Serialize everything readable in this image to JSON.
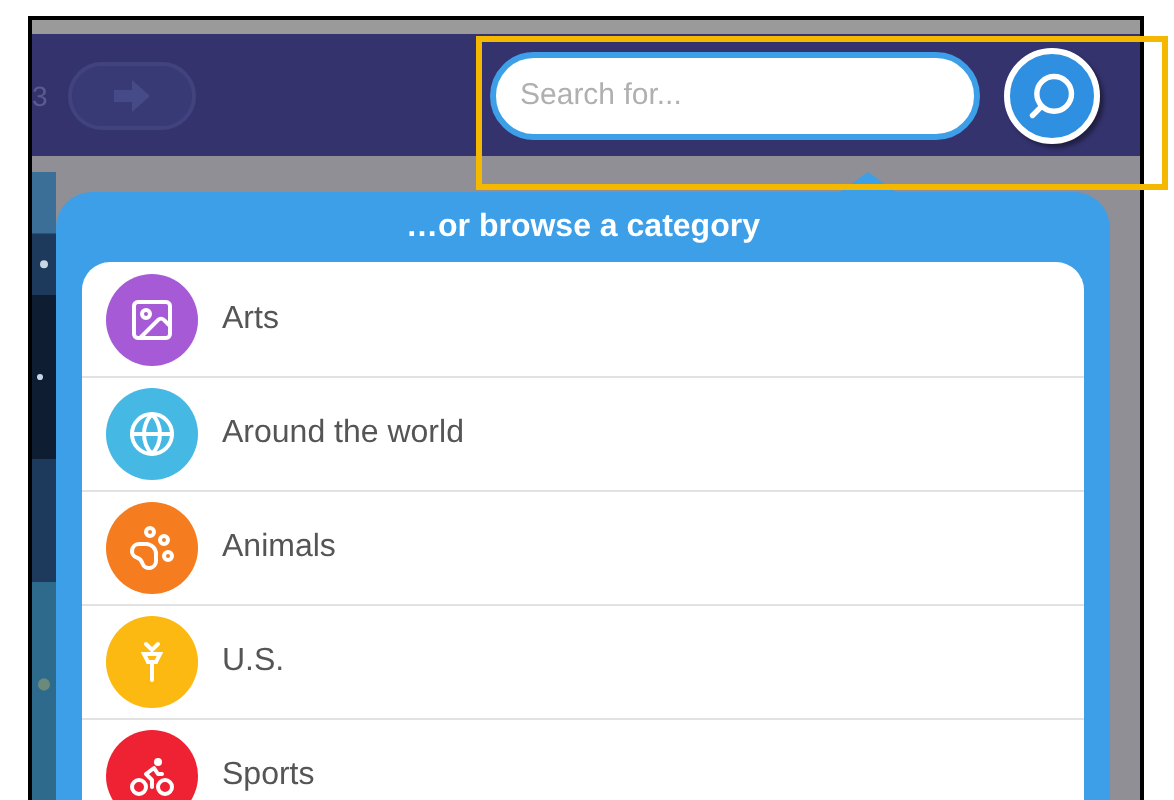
{
  "header": {
    "page_label": "3",
    "next_button": {
      "disabled": true
    },
    "search": {
      "placeholder": "Search for..."
    }
  },
  "browse": {
    "title": "…or browse a category",
    "categories": [
      {
        "label": "Arts",
        "kind": "arts",
        "color": "#a65ad6"
      },
      {
        "label": "Around the world",
        "kind": "world",
        "color": "#45b8e3"
      },
      {
        "label": "Animals",
        "kind": "animals",
        "color": "#f57c1f"
      },
      {
        "label": "U.S.",
        "kind": "us",
        "color": "#fbb911"
      },
      {
        "label": "Sports",
        "kind": "sports",
        "color": "#ee2233"
      }
    ]
  }
}
